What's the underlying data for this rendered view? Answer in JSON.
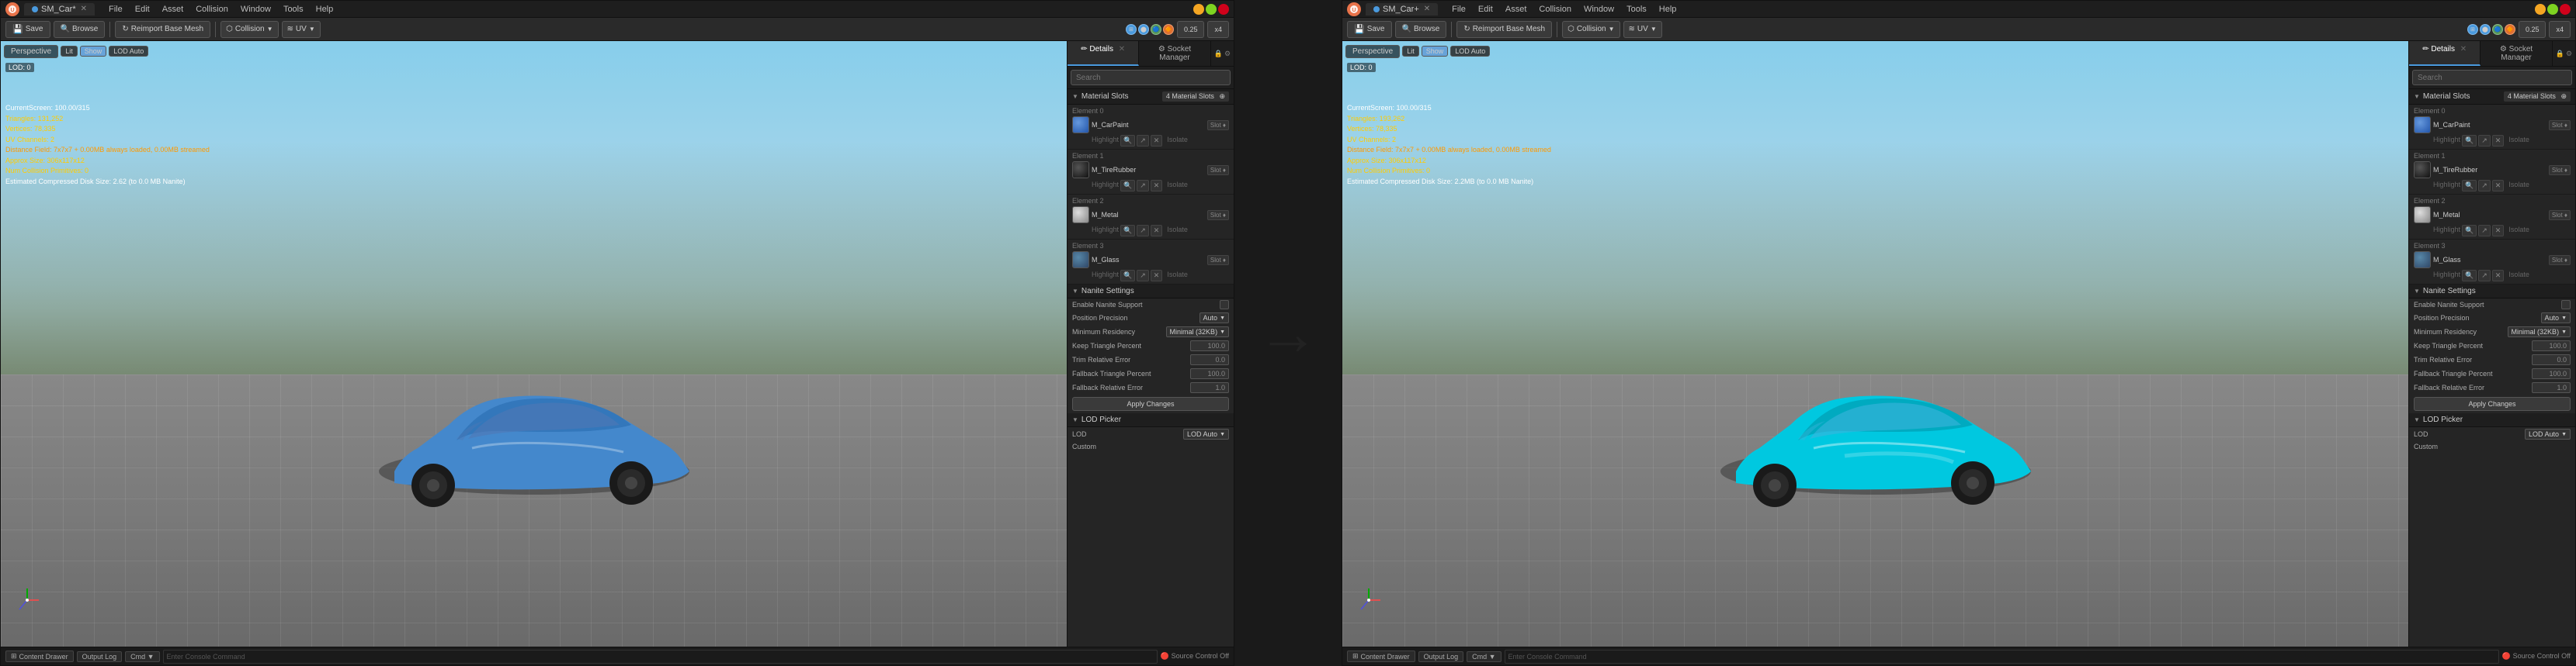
{
  "panel1": {
    "title": "SM_Car*",
    "menu": [
      "File",
      "Edit",
      "Asset",
      "Collision",
      "Window",
      "Tools",
      "Help"
    ],
    "toolbar": {
      "save": "Save",
      "browse": "Browse",
      "reimport": "Reimport Base Mesh",
      "collision": "Collision",
      "uv": "UV"
    },
    "viewport": {
      "perspective_label": "Perspective",
      "lod_label": "LOD 0",
      "show_label": "Show",
      "lod_auto": "LOD Auto",
      "stats": {
        "lod": "LOD: 0",
        "current_screen": "CurrentScreen: 100.00/315",
        "triangles": "Triangles: 131,252",
        "vertices": "Vertices: 78,335",
        "uv_channels": "UV Channels: 2",
        "distance_field": "Distance Field: 7x7x7 + 0.00MB always loaded, 0.00MB streamed",
        "approx_size": "Approx Size: 306x117x12",
        "num_collision": "Num Collision Primitives: 0",
        "estimated_disk": "Estimated Compressed Disk Size: 2.62 (to 0.0 MB Nanite)"
      }
    },
    "right_panel": {
      "tab_details": "Details",
      "tab_socket": "Socket Manager",
      "search_placeholder": "Search",
      "material_slots_label": "Material Slots",
      "material_slots_count": "4 Material Slots",
      "elements": [
        {
          "label": "Element 0",
          "sub_labels": [
            "Highlight",
            "Isolate"
          ],
          "material_name": "M_CarPaint",
          "slot": "Slot ♦",
          "color": "#4488cc"
        },
        {
          "label": "Element 1",
          "sub_labels": [
            "Highlight",
            "Isolate"
          ],
          "material_name": "M_TireRubber",
          "slot": "Slot ♦",
          "color": "#222222"
        },
        {
          "label": "Element 2",
          "sub_labels": [
            "Highlight",
            "Isolate"
          ],
          "material_name": "M_Metal",
          "slot": "Slot ♦",
          "color": "#aaaaaa"
        },
        {
          "label": "Element 3",
          "sub_labels": [
            "Highlight",
            "Isolate"
          ],
          "material_name": "M_Glass",
          "slot": "Slot ♦",
          "color": "#335577"
        }
      ],
      "nanite": {
        "section_label": "Nanite Settings",
        "enable_label": "Enable Nanite Support",
        "position_precision_label": "Position Precision",
        "position_precision_value": "Auto",
        "minimum_residency_label": "Minimum Residency",
        "minimum_residency_value": "Minimal (32KB)",
        "keep_triangle_label": "Keep Triangle Percent",
        "keep_triangle_value": "100.0",
        "trim_relative_label": "Trim Relative Error",
        "trim_relative_value": "0.0",
        "fallback_triangle_label": "Fallback Triangle Percent",
        "fallback_triangle_value": "100.0",
        "fallback_relative_label": "Fallback Relative Error",
        "fallback_relative_value": "1.0",
        "apply_btn": "Apply Changes"
      },
      "lod_picker": {
        "section_label": "LOD Picker",
        "lod_label": "LOD",
        "lod_value": "LOD Auto",
        "custom_label": "Custom"
      }
    },
    "bottom_bar": {
      "content_drawer": "Content Drawer",
      "output_log": "Output Log",
      "cmd": "Cmd ▼",
      "enter_console": "Enter Console Command",
      "source_control": "Source Control Off"
    }
  },
  "panel2": {
    "title": "SM_Car+",
    "viewport": {
      "perspective_label": "Perspective",
      "lod_label": "LOD 0",
      "show_label": "Show",
      "lod_auto": "LOD Auto"
    },
    "car_color": "#00c8e0",
    "bottom_bar": {
      "content_drawer": "Content Drawer",
      "output_log": "Output Log",
      "cmd": "Cmd ▼",
      "enter_console": "Enter Console Command",
      "source_control": "Source Control Off"
    }
  },
  "arrow": "→"
}
